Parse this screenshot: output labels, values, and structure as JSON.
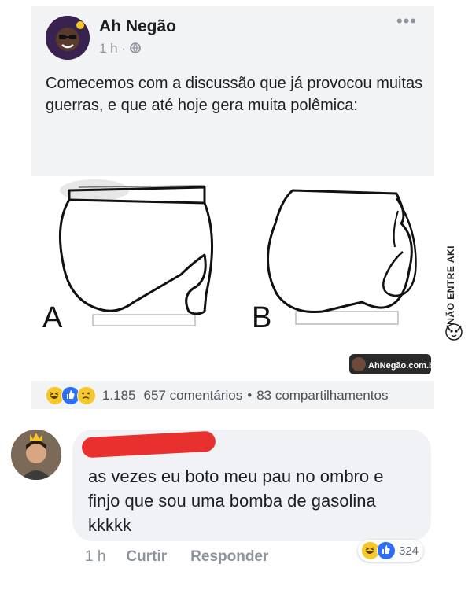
{
  "post": {
    "author": "Ah Negão",
    "time": "1 h",
    "privacy_icon": "globe-icon",
    "more_icon": "more-horizontal-icon",
    "text": "Comecemos com a discussão que já provocou muitas guerras, e que até hoje gera muita polêmica:",
    "image": {
      "label_a": "A",
      "label_b": "B",
      "watermark": "AhNegão.com.br"
    },
    "reactions": {
      "icons": [
        "haha-icon",
        "like-icon",
        "sad-icon"
      ],
      "count": "1.185",
      "comments": "657 comentários",
      "separator": "•",
      "shares": "83 compartilhamentos"
    }
  },
  "side_watermark": "NÃO ENTRE AKI",
  "comment": {
    "text": "as vezes eu boto meu pau no ombro e finjo que sou uma bomba de gasolina kkkkk",
    "time": "1 h",
    "like_label": "Curtir",
    "reply_label": "Responder",
    "reactions": {
      "icons": [
        "haha-icon",
        "like-icon"
      ],
      "count": "324"
    }
  },
  "colors": {
    "post_bg": "#f2f3f5",
    "bubble_bg": "#f0f2f5",
    "like_blue": "#2d6ef6",
    "haha_yellow": "#f7c829",
    "redaction_red": "#e8312f",
    "muted_text": "#8d949e"
  }
}
